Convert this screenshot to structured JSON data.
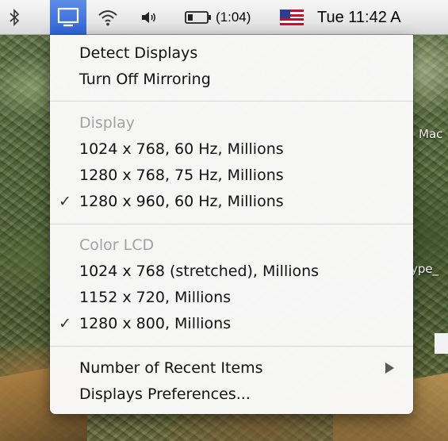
{
  "menubar": {
    "battery_time": "(1:04)",
    "clock": "Tue 11:42 A",
    "icons": [
      "bluetooth-icon",
      "display-icon",
      "wifi-icon",
      "volume-icon",
      "battery-icon",
      "flag-icon"
    ]
  },
  "menu": {
    "detect_displays": "Detect Displays",
    "turn_off_mirroring": "Turn Off Mirroring",
    "display_header": "Display",
    "display_modes": [
      {
        "label": "1024 x 768, 60 Hz, Millions",
        "checked": false
      },
      {
        "label": "1280 x 768, 75 Hz, Millions",
        "checked": false
      },
      {
        "label": "1280 x 960, 60 Hz, Millions",
        "checked": true
      }
    ],
    "color_lcd_header": "Color LCD",
    "lcd_modes": [
      {
        "label": "1024 x 768 (stretched), Millions",
        "checked": false
      },
      {
        "label": "1152 x 720, Millions",
        "checked": false
      },
      {
        "label": "1280 x 800, Millions",
        "checked": true
      }
    ],
    "recent_items": "Number of Recent Items",
    "preferences": "Displays Preferences...",
    "check_glyph": "✓"
  },
  "desktop": {
    "label_mac": "Mac",
    "label_type": "ype_"
  },
  "colors": {
    "highlight": "#2e63d6",
    "header_text": "#a2a2a2"
  }
}
